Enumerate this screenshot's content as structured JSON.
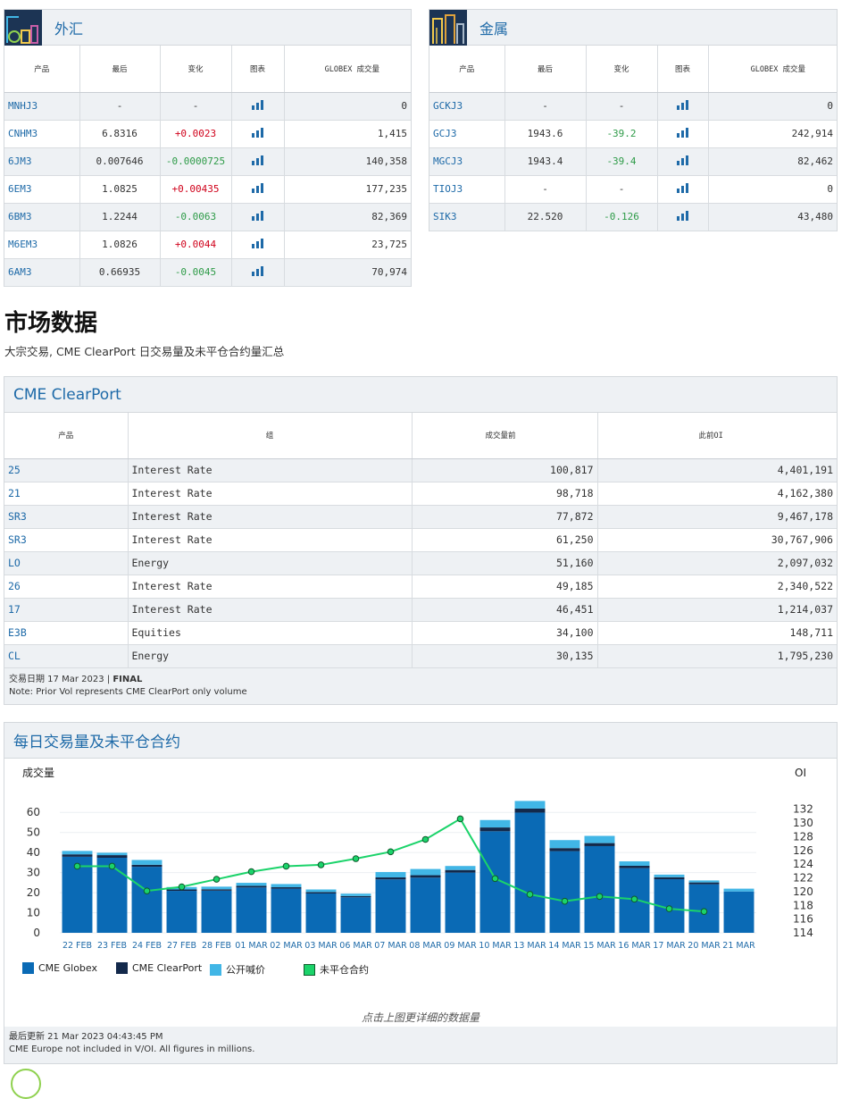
{
  "fx": {
    "title": "外汇",
    "headers": [
      "产品",
      "最后",
      "变化",
      "图表",
      "GLOBEX 成交量"
    ],
    "rows": [
      {
        "sym": "MNHJ3",
        "last": "-",
        "chg": "-",
        "vol": "0",
        "dir": "none"
      },
      {
        "sym": "CNHM3",
        "last": "6.8316",
        "chg": "+0.0023",
        "vol": "1,415",
        "dir": "up"
      },
      {
        "sym": "6JM3",
        "last": "0.007646",
        "chg": "-0.0000725",
        "vol": "140,358",
        "dir": "down"
      },
      {
        "sym": "6EM3",
        "last": "1.0825",
        "chg": "+0.00435",
        "vol": "177,235",
        "dir": "up"
      },
      {
        "sym": "6BM3",
        "last": "1.2244",
        "chg": "-0.0063",
        "vol": "82,369",
        "dir": "down"
      },
      {
        "sym": "M6EM3",
        "last": "1.0826",
        "chg": "+0.0044",
        "vol": "23,725",
        "dir": "up"
      },
      {
        "sym": "6AM3",
        "last": "0.66935",
        "chg": "-0.0045",
        "vol": "70,974",
        "dir": "down"
      }
    ]
  },
  "metals": {
    "title": "金属",
    "headers": [
      "产品",
      "最后",
      "变化",
      "图表",
      "GLOBEX 成交量"
    ],
    "rows": [
      {
        "sym": "GCKJ3",
        "last": "-",
        "chg": "-",
        "vol": "0",
        "dir": "none"
      },
      {
        "sym": "GCJ3",
        "last": "1943.6",
        "chg": "-39.2",
        "vol": "242,914",
        "dir": "down"
      },
      {
        "sym": "MGCJ3",
        "last": "1943.4",
        "chg": "-39.4",
        "vol": "82,462",
        "dir": "down"
      },
      {
        "sym": "TIOJ3",
        "last": "-",
        "chg": "-",
        "vol": "0",
        "dir": "none"
      },
      {
        "sym": "SIK3",
        "last": "22.520",
        "chg": "-0.126",
        "vol": "43,480",
        "dir": "down"
      }
    ]
  },
  "market": {
    "title": "市场数据",
    "subtitle": "大宗交易, CME ClearPort 日交易量及未平仓合约量汇总"
  },
  "clearport": {
    "title": "CME ClearPort",
    "headers": [
      "产品",
      "组",
      "成交量前",
      "此前OI"
    ],
    "rows": [
      {
        "sym": "25",
        "group": "Interest Rate",
        "vol": "100,817",
        "oi": "4,401,191"
      },
      {
        "sym": "21",
        "group": "Interest Rate",
        "vol": "98,718",
        "oi": "4,162,380"
      },
      {
        "sym": "SR3",
        "group": "Interest Rate",
        "vol": "77,872",
        "oi": "9,467,178"
      },
      {
        "sym": "SR3",
        "group": "Interest Rate",
        "vol": "61,250",
        "oi": "30,767,906"
      },
      {
        "sym": "LO",
        "group": "Energy",
        "vol": "51,160",
        "oi": "2,097,032"
      },
      {
        "sym": "26",
        "group": "Interest Rate",
        "vol": "49,185",
        "oi": "2,340,522"
      },
      {
        "sym": "17",
        "group": "Interest Rate",
        "vol": "46,451",
        "oi": "1,214,037"
      },
      {
        "sym": "E3B",
        "group": "Equities",
        "vol": "34,100",
        "oi": "148,711"
      },
      {
        "sym": "CL",
        "group": "Energy",
        "vol": "30,135",
        "oi": "1,795,230"
      }
    ],
    "trade_date": "交易日期 17 Mar 2023 | ",
    "final": "FINAL",
    "note": "Note: Prior Vol represents CME ClearPort only volume"
  },
  "daily": {
    "title": "每日交易量及未平仓合约",
    "click_hint": "点击上图更详细的数据量",
    "updated": "最后更新 21 Mar 2023 04:43:45 PM",
    "note": "CME Europe not included in V/OI. All figures in millions."
  },
  "colors": {
    "globex": "#0a6ab5",
    "clearport": "#13294b",
    "oc": "#41b6e6",
    "oi": "#1bd36a"
  },
  "chart_data": {
    "type": "bar",
    "ylabel": "成交量",
    "y2label": "OI",
    "ylim": [
      0,
      65
    ],
    "yticks": [
      0,
      10,
      20,
      30,
      40,
      50,
      60
    ],
    "y2lim": [
      114,
      133
    ],
    "y2ticks": [
      114,
      116,
      118,
      120,
      122,
      124,
      126,
      128,
      130,
      132
    ],
    "categories": [
      "22 FEB",
      "23 FEB",
      "24 FEB",
      "27 FEB",
      "28 FEB",
      "01 MAR",
      "02 MAR",
      "03 MAR",
      "06 MAR",
      "07 MAR",
      "08 MAR",
      "09 MAR",
      "10 MAR",
      "13 MAR",
      "14 MAR",
      "15 MAR",
      "16 MAR",
      "17 MAR",
      "20 MAR",
      "21 MAR"
    ],
    "series": [
      {
        "name": "CME Globex",
        "values": [
          37.9,
          37.4,
          32.9,
          20.9,
          21,
          22.6,
          22,
          19.6,
          17.7,
          26.6,
          27.5,
          30,
          50.6,
          59.9,
          40.7,
          43.2,
          32.2,
          26.7,
          24.2,
          20.6
        ]
      },
      {
        "name": "CME ClearPort",
        "values": [
          1.2,
          1.3,
          1,
          0.7,
          0.7,
          0.8,
          0.7,
          0.7,
          0.6,
          1,
          1.2,
          1.3,
          1.9,
          2,
          1.5,
          1.5,
          1.2,
          1,
          0.9,
          0
        ]
      },
      {
        "name": "公开喊价",
        "values": [
          1.7,
          1.2,
          2.4,
          1.2,
          1.3,
          1.5,
          1.6,
          1.3,
          1.2,
          2.7,
          3.1,
          2,
          3.7,
          3.8,
          4,
          3.6,
          2.2,
          1.3,
          1,
          1.4
        ]
      },
      {
        "name": "未平仓合约",
        "values": [
          123.7,
          123.7,
          120.1,
          120.7,
          121.8,
          122.9,
          123.7,
          123.9,
          124.8,
          125.8,
          127.6,
          130.6,
          121.9,
          119.6,
          118.6,
          119.3,
          118.9,
          117.5,
          117.1,
          null
        ]
      }
    ],
    "legend_position": "bottom-left"
  }
}
